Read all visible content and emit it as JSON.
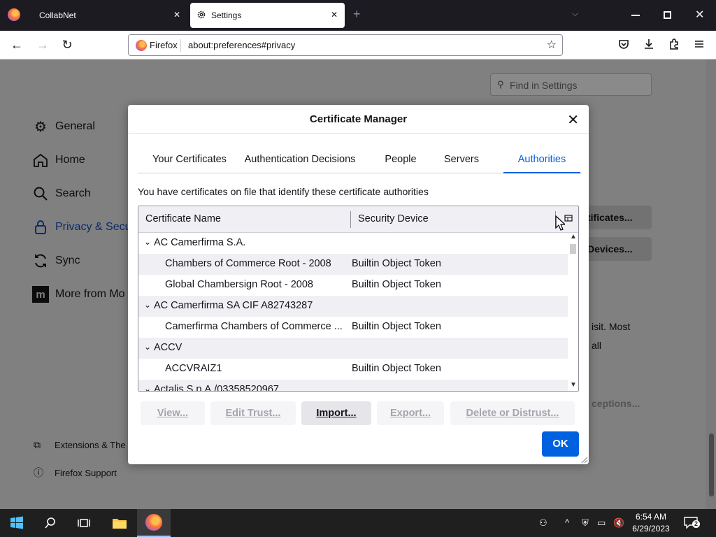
{
  "browser": {
    "tabs": [
      {
        "title": "CollabNet",
        "close": "✕"
      },
      {
        "title": "Settings",
        "close": "✕"
      }
    ],
    "new_tab": "+",
    "identity": "Firefox",
    "url": "about:preferences#privacy"
  },
  "settings": {
    "search_placeholder": "Find in Settings",
    "categories": [
      {
        "label": "General",
        "icon": "gear-icon"
      },
      {
        "label": "Home",
        "icon": "home-icon"
      },
      {
        "label": "Search",
        "icon": "search-icon"
      },
      {
        "label": "Privacy & Secu",
        "icon": "lock-icon"
      },
      {
        "label": "Sync",
        "icon": "sync-icon"
      },
      {
        "label": "More from Mo",
        "icon": "mozilla-icon"
      }
    ],
    "footer": [
      {
        "label": "Extensions & The",
        "icon": "puzzle-icon"
      },
      {
        "label": "Firefox Support",
        "icon": "help-icon"
      }
    ],
    "bg_buttons": [
      "tificates...",
      "Devices...",
      "ceptions..."
    ],
    "bg_text": [
      "isit. Most",
      "all"
    ]
  },
  "dialog": {
    "title": "Certificate Manager",
    "tabs": [
      "Your Certificates",
      "Authentication Decisions",
      "People",
      "Servers",
      "Authorities"
    ],
    "selected_tab": "Authorities",
    "intro": "You have certificates on file that identify these certificate authorities",
    "columns": [
      "Certificate Name",
      "Security Device"
    ],
    "rows": [
      {
        "type": "group",
        "name": "AC Camerfirma S.A."
      },
      {
        "type": "cert",
        "name": "Chambers of Commerce Root - 2008",
        "device": "Builtin Object Token"
      },
      {
        "type": "cert",
        "name": "Global Chambersign Root - 2008",
        "device": "Builtin Object Token"
      },
      {
        "type": "group",
        "name": "AC Camerfirma SA CIF A82743287"
      },
      {
        "type": "cert",
        "name": "Camerfirma Chambers of Commerce ...",
        "device": "Builtin Object Token"
      },
      {
        "type": "group",
        "name": "ACCV"
      },
      {
        "type": "cert",
        "name": "ACCVRAIZ1",
        "device": "Builtin Object Token"
      },
      {
        "type": "group",
        "name": "Actalis S.p.A./03358520967"
      }
    ],
    "buttons": [
      {
        "label": "View...",
        "enabled": false
      },
      {
        "label": "Edit Trust...",
        "enabled": false
      },
      {
        "label": "Import...",
        "enabled": true
      },
      {
        "label": "Export...",
        "enabled": false
      },
      {
        "label": "Delete or Distrust...",
        "enabled": false
      }
    ],
    "ok_label": "OK"
  },
  "taskbar": {
    "time": "6:54 AM",
    "date": "6/29/2023",
    "notifications": "2"
  },
  "colors": {
    "accent": "#0061e0",
    "tab_bar": "#1c1b22",
    "taskbar": "#1f1f1f"
  }
}
